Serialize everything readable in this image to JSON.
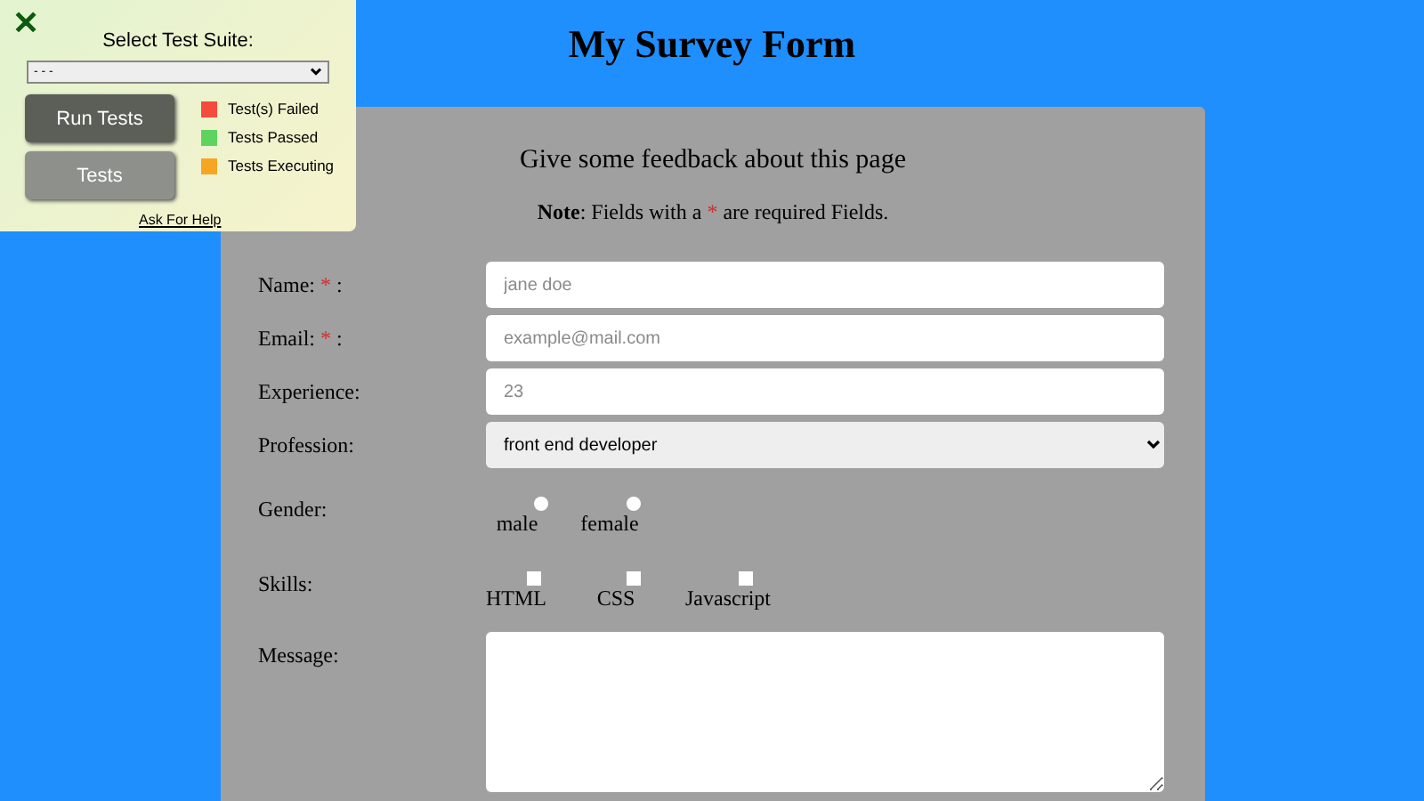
{
  "title": "My Survey Form",
  "test_panel": {
    "close": "✕",
    "suite_label": "Select Test Suite:",
    "suite_value": "- - -",
    "buttons": [
      {
        "label": "Run Tests",
        "kind": "primary"
      },
      {
        "label": "Tests",
        "kind": "secondary"
      }
    ],
    "legend": [
      {
        "label": "Test(s) Failed",
        "color": "#f44b3c"
      },
      {
        "label": "Tests Passed",
        "color": "#5fd35f"
      },
      {
        "label": "Tests Executing",
        "color": "#f5a623"
      }
    ],
    "help_link": "Ask For Help"
  },
  "form": {
    "heading": "Give some feedback about this page",
    "note": {
      "bold": "Note",
      "before": ": Fields with a ",
      "mark": "*",
      "after": " are required Fields."
    },
    "fields": [
      {
        "kind": "text",
        "label": "Name:",
        "required": true,
        "after": ":",
        "placeholder": "jane doe"
      },
      {
        "kind": "text",
        "label": "Email:",
        "required": true,
        "after": ":",
        "placeholder": "example@mail.com"
      },
      {
        "kind": "text",
        "label": "Experience:",
        "required": false,
        "placeholder": "23"
      },
      {
        "kind": "select",
        "label": "Profession:",
        "required": false,
        "value": "front end developer"
      },
      {
        "kind": "radio",
        "label": "Gender:",
        "required": false,
        "options": [
          {
            "label": "male",
            "selected": false
          },
          {
            "label": "female",
            "selected": false
          }
        ]
      },
      {
        "kind": "checkbox",
        "label": "Skills:",
        "required": false,
        "options": [
          {
            "label": "HTML",
            "checked": false
          },
          {
            "label": "CSS",
            "checked": false
          },
          {
            "label": "Javascript",
            "checked": false
          }
        ]
      },
      {
        "kind": "textarea",
        "label": "Message:",
        "required": false
      }
    ]
  }
}
